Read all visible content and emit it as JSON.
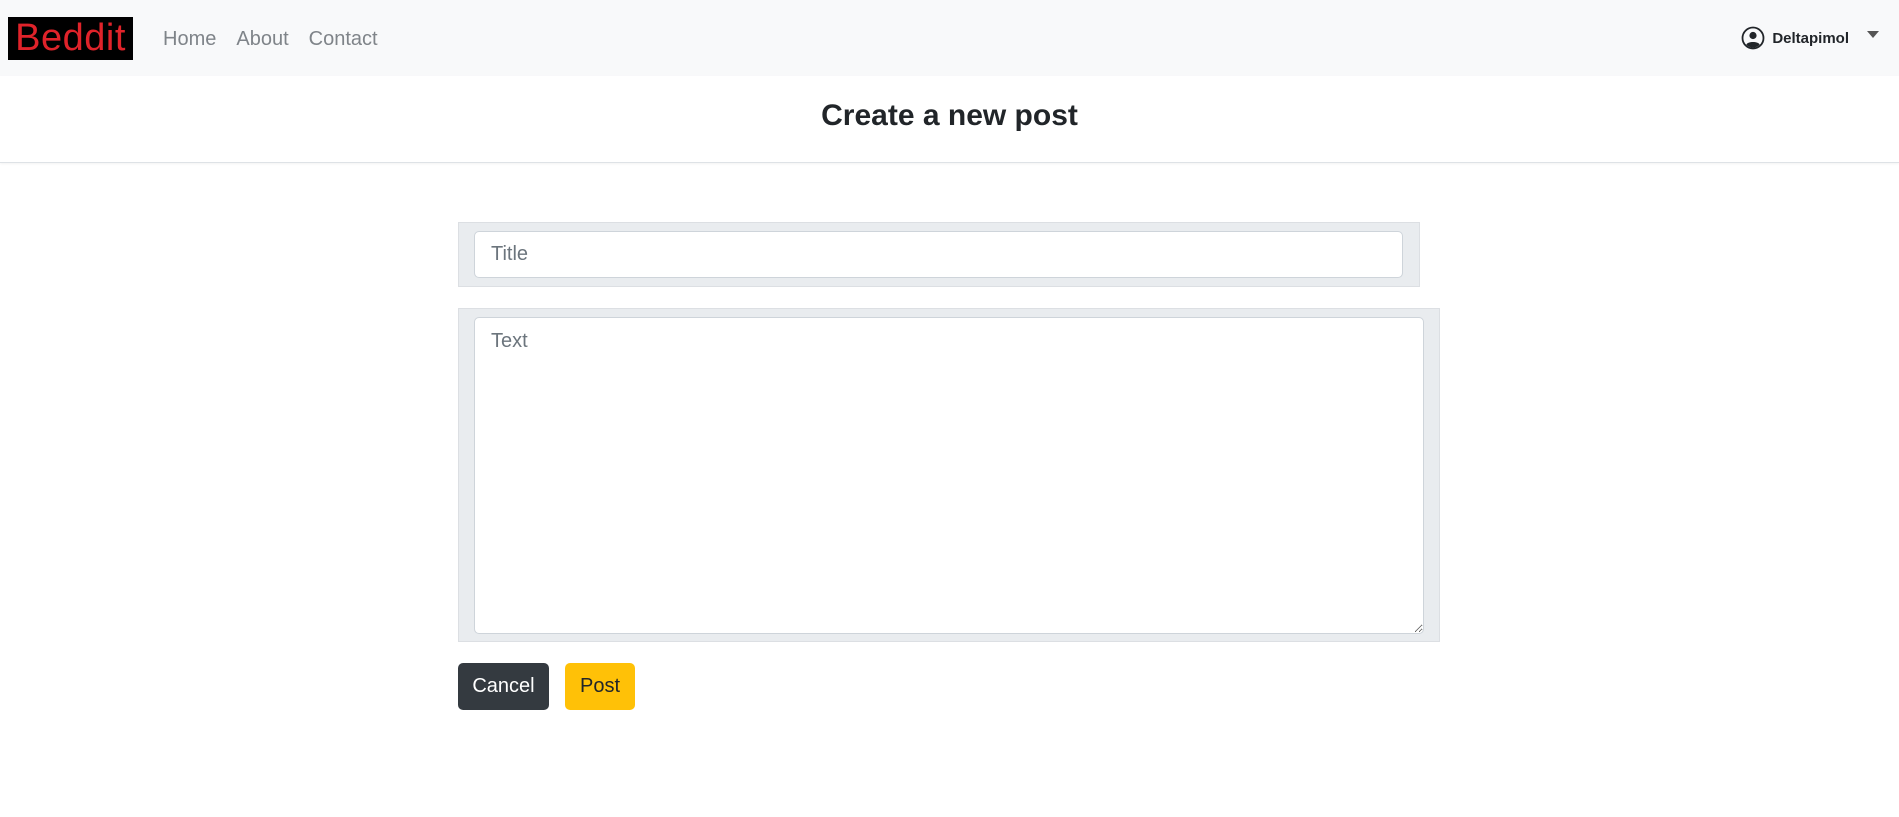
{
  "navbar": {
    "brand": "Beddit",
    "links": [
      "Home",
      "About",
      "Contact"
    ],
    "user": {
      "icon": "user-circle-icon",
      "name": "Deltapimol",
      "dropdown_icon": "caret-down-icon"
    }
  },
  "header": {
    "title": "Create a new post"
  },
  "form": {
    "title_placeholder": "Title",
    "title_value": "",
    "text_placeholder": "Text",
    "text_value": "",
    "cancel_label": "Cancel",
    "post_label": "Post"
  },
  "colors": {
    "brand_text": "#e0232a",
    "brand_bg": "#000000",
    "navbar_bg": "#f8f9fa",
    "cancel_bg": "#343a40",
    "post_bg": "#ffc107"
  }
}
